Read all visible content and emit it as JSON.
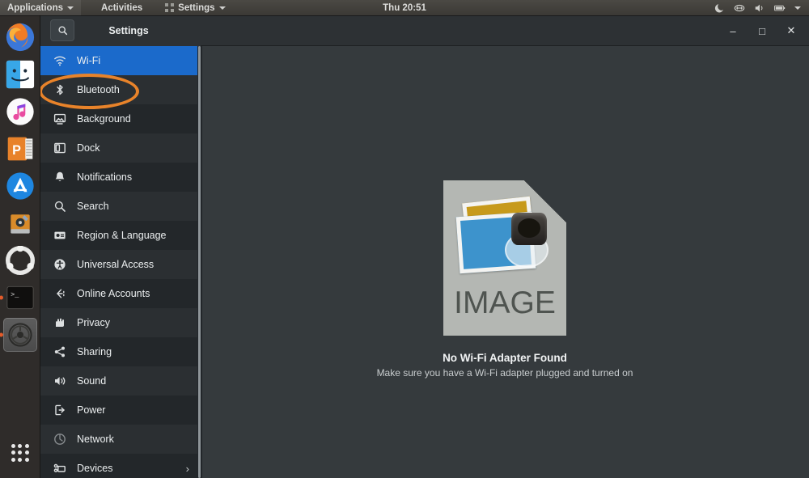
{
  "topbar": {
    "applications_label": "Applications",
    "activities_label": "Activities",
    "settings_label": "Settings",
    "clock": "Thu 20:51",
    "status_icons": [
      "night-mode-icon",
      "network-link-icon",
      "volume-icon",
      "battery-icon",
      "chevron-down-icon"
    ]
  },
  "dock": {
    "items": [
      {
        "name": "firefox",
        "running": false
      },
      {
        "name": "files",
        "running": false
      },
      {
        "name": "music",
        "running": false
      },
      {
        "name": "impress",
        "running": false
      },
      {
        "name": "software-store",
        "running": false
      },
      {
        "name": "disk-utility",
        "running": false
      },
      {
        "name": "ubuntu-help",
        "running": false
      },
      {
        "name": "terminal",
        "running": true
      },
      {
        "name": "settings",
        "running": true
      }
    ],
    "show_apps_label": "Show Applications"
  },
  "window": {
    "title": "Settings",
    "search_icon": "search-icon",
    "controls": {
      "minimize": "–",
      "maximize": "□",
      "close": "✕"
    }
  },
  "sidebar": {
    "items": [
      {
        "label": "Wi-Fi",
        "icon": "wifi-icon",
        "selected": true,
        "chevron": false
      },
      {
        "label": "Bluetooth",
        "icon": "bluetooth-icon",
        "selected": false,
        "chevron": false
      },
      {
        "label": "Background",
        "icon": "background-icon",
        "selected": false,
        "chevron": false
      },
      {
        "label": "Dock",
        "icon": "dock-icon",
        "selected": false,
        "chevron": false
      },
      {
        "label": "Notifications",
        "icon": "notifications-icon",
        "selected": false,
        "chevron": false
      },
      {
        "label": "Search",
        "icon": "search-icon",
        "selected": false,
        "chevron": false
      },
      {
        "label": "Region & Language",
        "icon": "region-language-icon",
        "selected": false,
        "chevron": false
      },
      {
        "label": "Universal Access",
        "icon": "universal-access-icon",
        "selected": false,
        "chevron": false
      },
      {
        "label": "Online Accounts",
        "icon": "online-accounts-icon",
        "selected": false,
        "chevron": false
      },
      {
        "label": "Privacy",
        "icon": "privacy-icon",
        "selected": false,
        "chevron": false
      },
      {
        "label": "Sharing",
        "icon": "sharing-icon",
        "selected": false,
        "chevron": false
      },
      {
        "label": "Sound",
        "icon": "sound-icon",
        "selected": false,
        "chevron": false
      },
      {
        "label": "Power",
        "icon": "power-icon",
        "selected": false,
        "chevron": false
      },
      {
        "label": "Network",
        "icon": "network-icon",
        "selected": false,
        "chevron": false
      },
      {
        "label": "Devices",
        "icon": "devices-icon",
        "selected": false,
        "chevron": true
      }
    ]
  },
  "annotation": {
    "shape": "ellipse",
    "color": "#e8832a",
    "targets": "Bluetooth"
  },
  "main": {
    "placeholder_label": "IMAGE",
    "placeholder_icon": "broken-image-icon",
    "message_title": "No Wi-Fi Adapter Found",
    "message_subtitle": "Make sure you have a Wi-Fi adapter plugged and turned on"
  },
  "colors": {
    "accent_blue": "#1b6acb",
    "annotation_orange": "#e8832a",
    "window_bg": "#353a3d",
    "sidebar_bg": "#23272a",
    "topbar_bg": "#3b3935"
  }
}
